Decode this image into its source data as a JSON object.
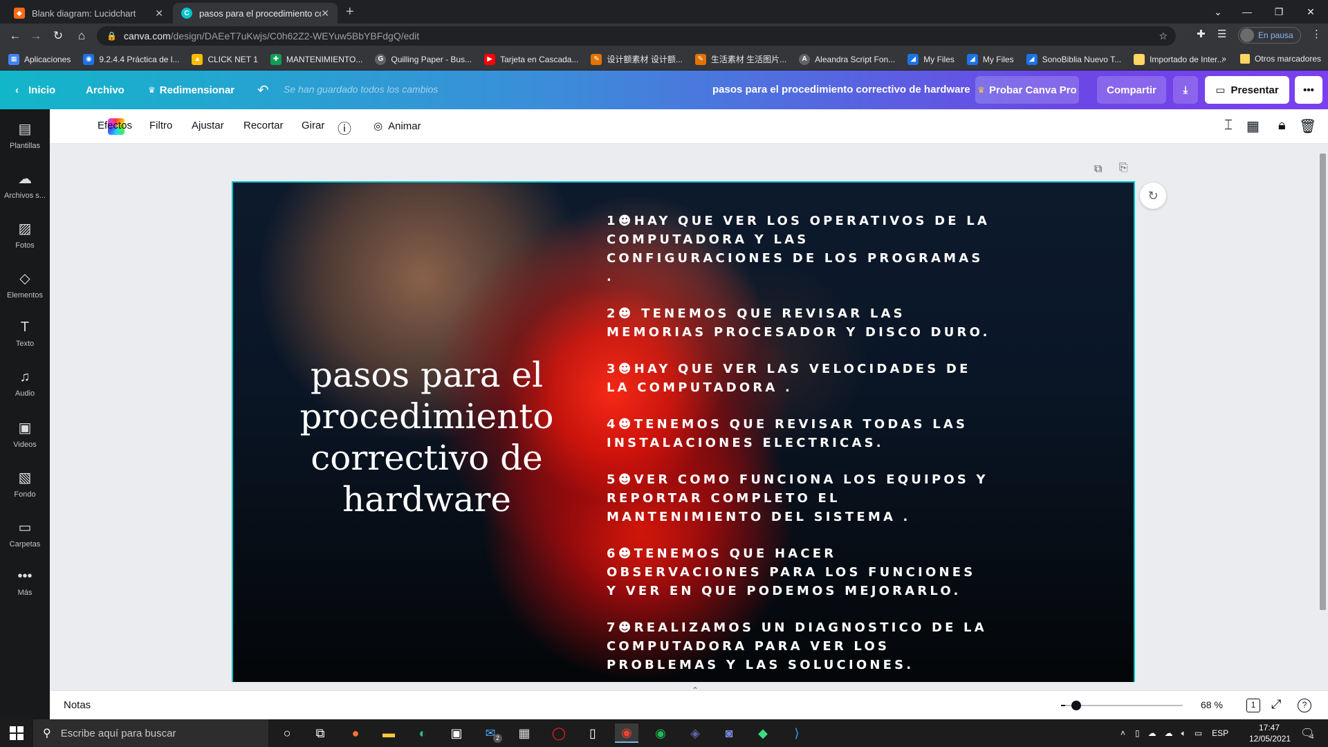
{
  "browser": {
    "tabs": [
      {
        "title": "Blank diagram: Lucidchart",
        "active": false
      },
      {
        "title": "pasos para el procedimiento corre",
        "active": true
      }
    ],
    "url_host": "canva.com",
    "url_path": "/design/DAEeT7uKwjs/C0h62Z2-WEYuw5BbYBFdgQ/edit",
    "profile_status": "En pausa",
    "bookmarks": [
      "Aplicaciones",
      "9.2.4.4 Práctica de l...",
      "CLICK NET 1",
      "MANTENIMIENTO...",
      "Quilling Paper - Bus...",
      "Tarjeta en Cascada...",
      "设计额素材 设计额...",
      "生活素材 生活图片...",
      "Aleandra Script Fon...",
      "My Files",
      "My Files",
      "SonoBiblia Nuevo T...",
      "Importado de Inter..."
    ],
    "bookmarks_more": "»",
    "other_bookmarks": "Otros marcadores"
  },
  "canva_header": {
    "home": "Inicio",
    "file": "Archivo",
    "resize": "Redimensionar",
    "saved_status": "Se han guardado todos los cambios",
    "doc_title": "pasos para el procedimiento correctivo de hardware",
    "try_pro": "Probar Canva Pro",
    "share": "Compartir",
    "present": "Presentar",
    "more": "•••"
  },
  "sidebar": {
    "items": [
      {
        "label": "Plantillas",
        "icon": "templates-icon"
      },
      {
        "label": "Archivos s...",
        "icon": "upload-icon"
      },
      {
        "label": "Fotos",
        "icon": "photos-icon"
      },
      {
        "label": "Elementos",
        "icon": "elements-icon"
      },
      {
        "label": "Texto",
        "icon": "text-icon"
      },
      {
        "label": "Audio",
        "icon": "audio-icon"
      },
      {
        "label": "Videos",
        "icon": "video-icon"
      },
      {
        "label": "Fondo",
        "icon": "background-icon"
      },
      {
        "label": "Carpetas",
        "icon": "folder-icon"
      },
      {
        "label": "Más",
        "icon": "more-icon"
      }
    ]
  },
  "toolbar": {
    "effects": "Efectos",
    "filter": "Filtro",
    "adjust": "Ajustar",
    "crop": "Recortar",
    "rotate": "Girar",
    "animate": "Animar"
  },
  "slide": {
    "title": "pasos para el procedimiento correctivo de hardware",
    "steps": [
      "1☻HAY QUE VER LOS OPERATIVOS DE LA COMPUTADORA Y LAS CONFIGURACIONES DE LOS PROGRAMAS .",
      "2☻ TENEMOS QUE REVISAR LAS MEMORIAS PROCESADOR Y DISCO DURO.",
      "3☻HAY QUE VER LAS VELOCIDADES DE LA COMPUTADORA .",
      "4☻TENEMOS QUE REVISAR TODAS LAS INSTALACIONES ELECTRICAS.",
      "5☻VER COMO FUNCIONA LOS EQUIPOS Y REPORTAR COMPLETO EL MANTENIMIENTO DEL SISTEMA .",
      "6☻TENEMOS QUE HACER OBSERVACIONES PARA LOS FUNCIONES Y VER EN QUE PODEMOS MEJORARLO.",
      "7☻REALIZAMOS UN DIAGNOSTICO DE LA COMPUTADORA PARA VER LOS PROBLEMAS Y LAS SOLUCIONES."
    ]
  },
  "bottom_bar": {
    "notes": "Notas",
    "zoom": "68 %",
    "page_count": "1",
    "help": "?"
  },
  "taskbar": {
    "search_placeholder": "Escribe aquí para buscar",
    "language": "ESP",
    "time": "17:47",
    "date": "12/05/2021",
    "notifications": "4",
    "mail_badge": "2"
  }
}
